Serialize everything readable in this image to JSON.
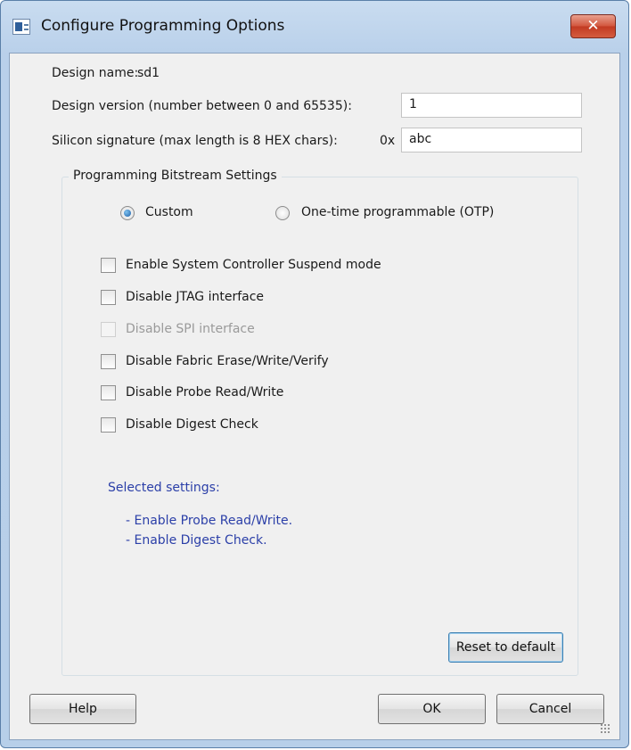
{
  "window": {
    "title": "Configure Programming Options",
    "close_glyph": "✕"
  },
  "design": {
    "name_label": "Design name:",
    "name_value": "sd1",
    "version_label": "Design version (number between 0 and 65535):",
    "version_value": "1",
    "signature_label": "Silicon signature (max length is 8 HEX chars):",
    "signature_prefix": "0x",
    "signature_value": "abc"
  },
  "bitstream": {
    "group_title": "Programming Bitstream Settings",
    "radios": [
      {
        "label": "Custom",
        "checked": true
      },
      {
        "label": "One-time programmable (OTP)",
        "checked": false
      }
    ],
    "checkboxes": [
      {
        "label": "Enable System Controller Suspend mode",
        "checked": false,
        "enabled": true
      },
      {
        "label": "Disable JTAG interface",
        "checked": false,
        "enabled": true
      },
      {
        "label": "Disable SPI interface",
        "checked": false,
        "enabled": false
      },
      {
        "label": "Disable Fabric Erase/Write/Verify",
        "checked": false,
        "enabled": true
      },
      {
        "label": "Disable Probe Read/Write",
        "checked": false,
        "enabled": true
      },
      {
        "label": "Disable Digest Check",
        "checked": false,
        "enabled": true
      }
    ],
    "summary_title": "Selected settings:",
    "summary_lines": [
      "- Enable Probe Read/Write.",
      "- Enable Digest Check."
    ],
    "reset_label": "Reset to default"
  },
  "buttons": {
    "help": "Help",
    "ok": "OK",
    "cancel": "Cancel"
  },
  "colors": {
    "summary_text": "#2b3fa8",
    "close_button": "#c23a22",
    "frame": "#b9d0ea"
  }
}
